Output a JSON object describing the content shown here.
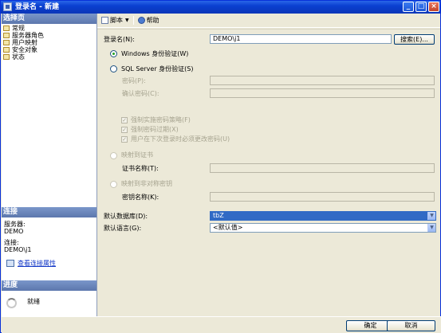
{
  "window": {
    "title": "登录名 - 新建",
    "minimize": "_",
    "maximize": "□",
    "close": "×"
  },
  "left": {
    "select_page_header": "选择页",
    "pages": [
      "常规",
      "服务器角色",
      "用户映射",
      "安全对象",
      "状态"
    ],
    "connection_header": "连接",
    "server_label": "服务器:",
    "server_value": "DEMO",
    "connection_label": "连接:",
    "connection_value": "DEMO\\j1",
    "view_props_link": "查看连接属性",
    "progress_header": "进度",
    "progress_status": "就绪"
  },
  "toolbar": {
    "script_label": "脚本",
    "help_label": "帮助"
  },
  "form": {
    "login_name_label": "登录名(N):",
    "login_name_value": "DEMO\\j1",
    "search_button": "搜索(E)...",
    "windows_auth_label": "Windows 身份验证(W)",
    "sql_auth_label": "SQL Server 身份验证(S)",
    "password_label": "密码(P):",
    "confirm_password_label": "确认密码(C):",
    "enforce_policy_label": "强制实施密码策略(F)",
    "enforce_expiry_label": "强制密码过期(X)",
    "must_change_label": "用户在下次登录时必须更改密码(U)",
    "cert_mapped_label": "映射到证书",
    "cert_name_label": "证书名称(T):",
    "asym_key_label": "映射到非对称密钥",
    "key_name_label": "密钥名称(K):",
    "default_db_label": "默认数据库(D):",
    "default_db_value": "tbZ",
    "default_lang_label": "默认语言(G):",
    "default_lang_value": "<默认值>"
  },
  "footer": {
    "ok_button": "确定",
    "cancel_button": "取消"
  },
  "colors": {
    "titlebar": "#0a3fd0",
    "section_header": "#5c77ad",
    "selection": "#316ac5",
    "dialog_bg": "#ece9d8"
  }
}
